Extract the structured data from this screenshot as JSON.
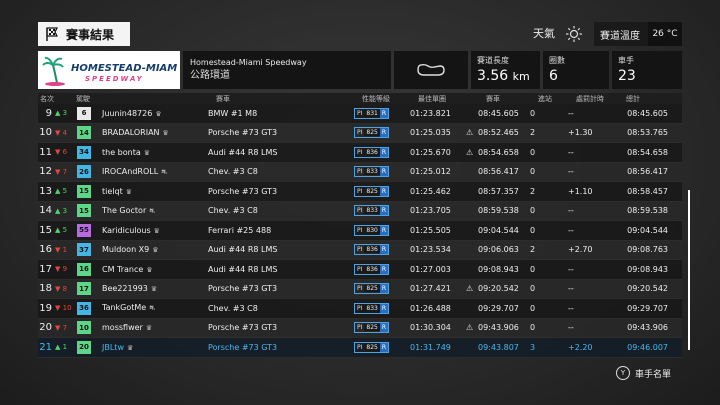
{
  "header": {
    "title": "賽事結果",
    "weather_label": "天氣",
    "track_temp_label": "賽道溫度",
    "track_temp_value": "26 °C"
  },
  "track": {
    "logo_line1": "HOMESTEAD-MIAMI",
    "logo_line2": "SPEEDWAY",
    "name": "Homestead-Miami Speedway",
    "layout": "公路環道",
    "length_label": "賽道長度",
    "length_value": "3.56",
    "length_unit": "km",
    "laps_label": "圈數",
    "laps_value": "6",
    "drivers_label": "車手",
    "drivers_value": "23"
  },
  "columns": {
    "pos": "名次",
    "driver": "駕駛",
    "car": "賽車",
    "pi": "性能等級",
    "best": "最佳單圈",
    "race": "賽車",
    "pit": "進站",
    "penalty": "處罰計時",
    "total": "總計"
  },
  "rows": [
    {
      "pos": "9",
      "chg": "3",
      "dir": "up",
      "lvl": "6",
      "lvlc": "#e9e9e9",
      "name": "Juunin48726",
      "crown": "♛",
      "car": "BMW #1 M8",
      "pi": "831",
      "best": "01:23.821",
      "warn": "",
      "race": "08:45.605",
      "pit": "0",
      "pen": "--",
      "total": "08:45.605"
    },
    {
      "pos": "10",
      "chg": "4",
      "dir": "down",
      "lvl": "14",
      "lvlc": "#5ed68a",
      "name": "BRADALORIAN",
      "crown": "♛",
      "car": "Porsche #73 GT3",
      "pi": "825",
      "best": "01:25.035",
      "warn": "⚠",
      "race": "08:52.465",
      "pit": "2",
      "pen": "+1.30",
      "total": "08:53.765"
    },
    {
      "pos": "11",
      "chg": "6",
      "dir": "down",
      "lvl": "34",
      "lvlc": "#44b6e6",
      "name": "the bonta",
      "crown": "♛",
      "car": "Audi #44 R8 LMS",
      "pi": "836",
      "best": "01:25.670",
      "warn": "⚠",
      "race": "08:54.658",
      "pit": "0",
      "pen": "--",
      "total": "08:54.658"
    },
    {
      "pos": "12",
      "chg": "7",
      "dir": "down",
      "lvl": "26",
      "lvlc": "#44b6e6",
      "name": "IROCAndROLL",
      "crown": "⛐",
      "car": "Chev. #3 C8",
      "pi": "833",
      "best": "01:25.012",
      "warn": "",
      "race": "08:56.417",
      "pit": "0",
      "pen": "--",
      "total": "08:56.417"
    },
    {
      "pos": "13",
      "chg": "5",
      "dir": "up",
      "lvl": "15",
      "lvlc": "#5ed68a",
      "name": "tielqt",
      "crown": "♛",
      "car": "Porsche #73 GT3",
      "pi": "825",
      "best": "01:25.462",
      "warn": "",
      "race": "08:57.357",
      "pit": "2",
      "pen": "+1.10",
      "total": "08:58.457"
    },
    {
      "pos": "14",
      "chg": "3",
      "dir": "up",
      "lvl": "15",
      "lvlc": "#5ed68a",
      "name": "The Goctor",
      "crown": "⛐",
      "car": "Chev. #3 C8",
      "pi": "833",
      "best": "01:23.705",
      "warn": "",
      "race": "08:59.538",
      "pit": "0",
      "pen": "--",
      "total": "08:59.538"
    },
    {
      "pos": "15",
      "chg": "5",
      "dir": "up",
      "lvl": "55",
      "lvlc": "#b86be0",
      "name": "Karidiculous",
      "crown": "♛",
      "car": "Ferrari #25 488",
      "pi": "830",
      "best": "01:25.505",
      "warn": "",
      "race": "09:04.544",
      "pit": "0",
      "pen": "--",
      "total": "09:04.544"
    },
    {
      "pos": "16",
      "chg": "1",
      "dir": "down",
      "lvl": "37",
      "lvlc": "#44b6e6",
      "name": "Muldoon X9",
      "crown": "♛",
      "car": "Audi #44 R8 LMS",
      "pi": "836",
      "best": "01:23.534",
      "warn": "",
      "race": "09:06.063",
      "pit": "2",
      "pen": "+2.70",
      "total": "09:08.763"
    },
    {
      "pos": "17",
      "chg": "9",
      "dir": "down",
      "lvl": "16",
      "lvlc": "#5ed68a",
      "name": "CM Trance",
      "crown": "♛",
      "car": "Audi #44 R8 LMS",
      "pi": "836",
      "best": "01:27.003",
      "warn": "",
      "race": "09:08.943",
      "pit": "0",
      "pen": "--",
      "total": "09:08.943"
    },
    {
      "pos": "18",
      "chg": "8",
      "dir": "down",
      "lvl": "17",
      "lvlc": "#5ed68a",
      "name": "Bee221993",
      "crown": "♛",
      "car": "Porsche #73 GT3",
      "pi": "825",
      "best": "01:27.421",
      "warn": "⚠",
      "race": "09:20.542",
      "pit": "0",
      "pen": "--",
      "total": "09:20.542"
    },
    {
      "pos": "19",
      "chg": "10",
      "dir": "down",
      "lvl": "36",
      "lvlc": "#44b6e6",
      "name": "TankGotMe",
      "crown": "⛐",
      "car": "Chev. #3 C8",
      "pi": "833",
      "best": "01:26.488",
      "warn": "",
      "race": "09:29.707",
      "pit": "0",
      "pen": "--",
      "total": "09:29.707"
    },
    {
      "pos": "20",
      "chg": "7",
      "dir": "down",
      "lvl": "10",
      "lvlc": "#5ed68a",
      "name": "mossflwer",
      "crown": "♛",
      "car": "Porsche #73 GT3",
      "pi": "825",
      "best": "01:30.304",
      "warn": "⚠",
      "race": "09:43.906",
      "pit": "0",
      "pen": "--",
      "total": "09:43.906"
    },
    {
      "pos": "21",
      "chg": "1",
      "dir": "up",
      "lvl": "20",
      "lvlc": "#5ed68a",
      "name": "JBLtw",
      "crown": "♛",
      "car": "Porsche #73 GT3",
      "pi": "825",
      "best": "01:31.749",
      "warn": "",
      "race": "09:43.807",
      "pit": "3",
      "pen": "+2.20",
      "total": "09:46.007",
      "me": true
    }
  ],
  "pi_class_letter": "R",
  "pi_prefix": "PI",
  "footer": {
    "button": "Y",
    "label": "車手名單"
  }
}
